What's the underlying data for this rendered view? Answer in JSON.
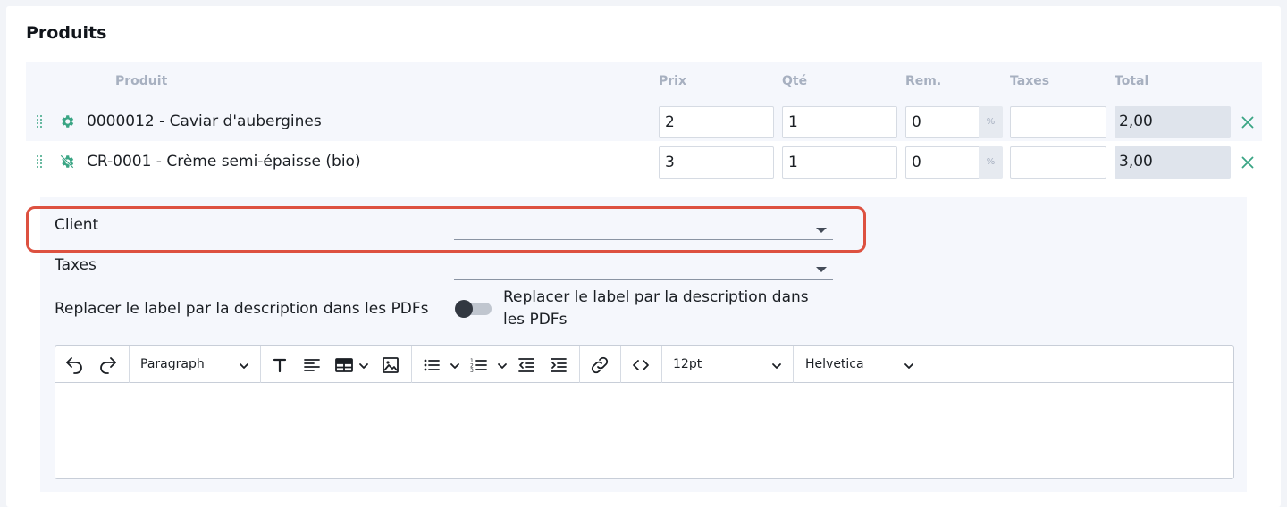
{
  "section": {
    "title": "Produits"
  },
  "table": {
    "headers": {
      "product": "Produit",
      "price": "Prix",
      "qty": "Qté",
      "discount": "Rem.",
      "taxes": "Taxes",
      "total": "Total"
    },
    "rows": [
      {
        "name": "0000012 - Caviar d'aubergines",
        "price": "2",
        "qty": "1",
        "discount": "0",
        "discount_unit": "%",
        "taxes": "",
        "total": "2,00",
        "icon": "gear-icon"
      },
      {
        "name": "CR-0001 - Crème semi-épaisse (bio)",
        "price": "3",
        "qty": "1",
        "discount": "0",
        "discount_unit": "%",
        "taxes": "",
        "total": "3,00",
        "icon": "gear-off-icon"
      }
    ]
  },
  "form": {
    "client_label": "Client",
    "client_value": "",
    "taxes_label": "Taxes",
    "taxes_value": "",
    "replace_label": "Replacer le label par la description dans les PDFs",
    "replace_toggle_label": "Replacer le label par la description dans les PDFs",
    "replace_toggle_on": false
  },
  "editor": {
    "block_format": "Paragraph",
    "font_size": "12pt",
    "font_family": "Helvetica",
    "content": ""
  },
  "colors": {
    "accent": "#3aa584",
    "highlight": "#dd5140",
    "header_text": "#a7b0c0"
  }
}
